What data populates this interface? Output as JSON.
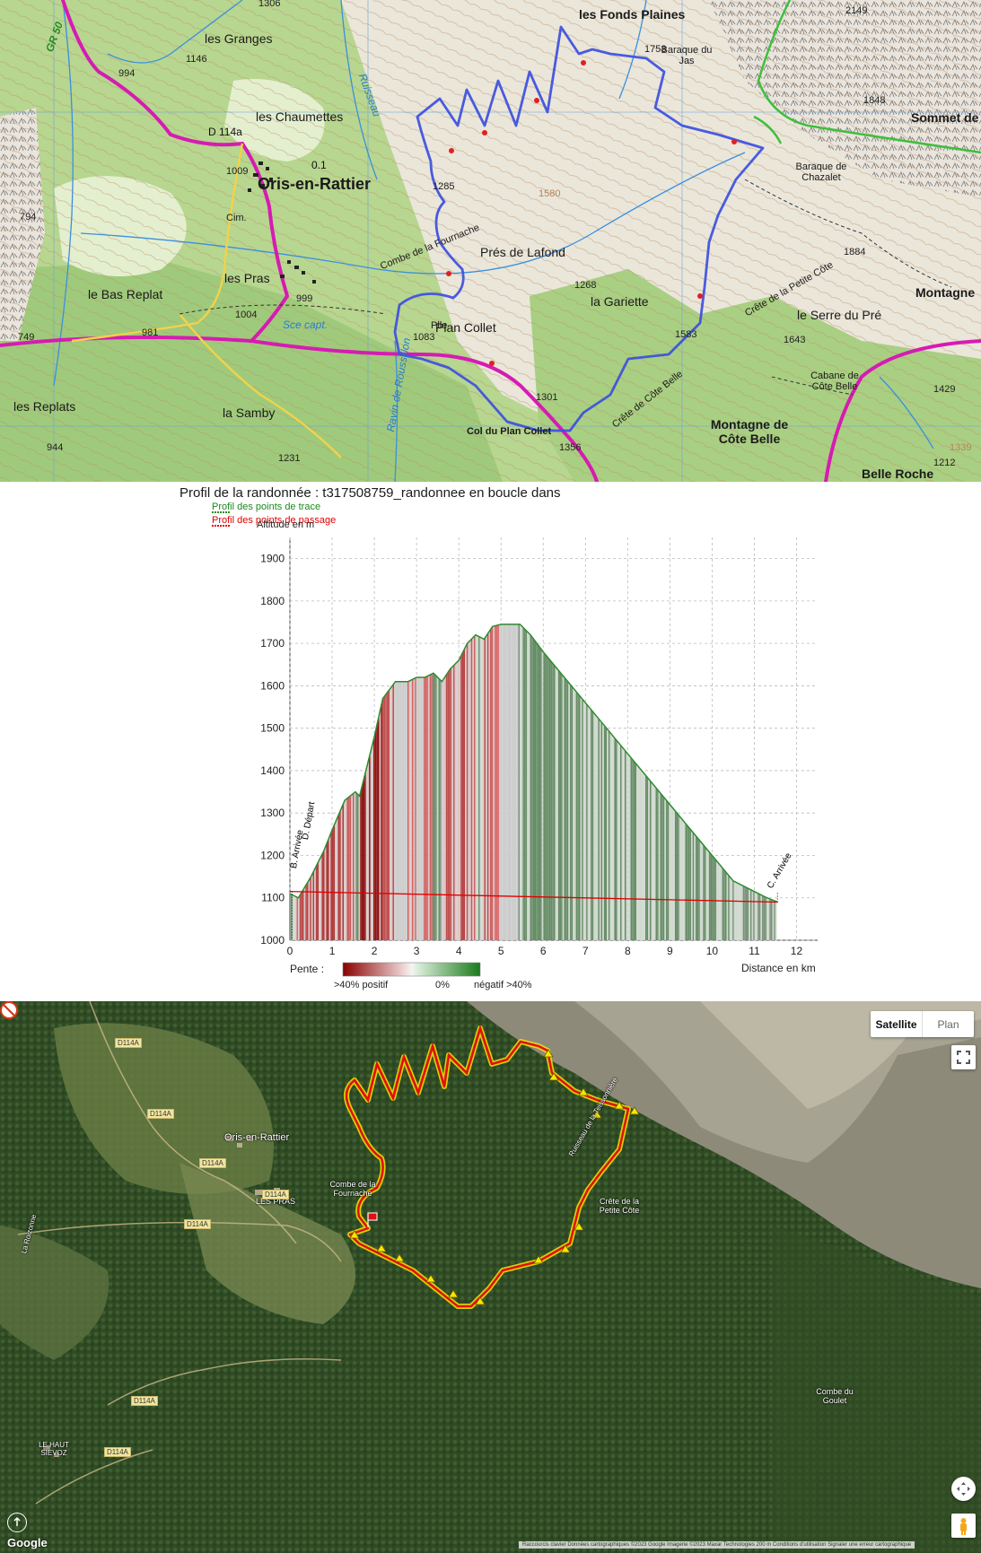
{
  "topo_map": {
    "places": [
      {
        "name": "les Granges"
      },
      {
        "name": "les Chaumettes"
      },
      {
        "name": "Oris-en-Rattier"
      },
      {
        "name": "les Fonds Plaines"
      },
      {
        "name": "Baraque du Jas"
      },
      {
        "name": "Sommet de"
      },
      {
        "name": "Baraque de Chazalet"
      },
      {
        "name": "Combe de la Fournache"
      },
      {
        "name": "Prés de Lafond"
      },
      {
        "name": "la Gariette"
      },
      {
        "name": "Crête de la Petite Côte"
      },
      {
        "name": "Montagne"
      },
      {
        "name": "le Serre du Pré"
      },
      {
        "name": "les Pras"
      },
      {
        "name": "le Bas Replat"
      },
      {
        "name": "Plan Collet"
      },
      {
        "name": "Sce capt."
      },
      {
        "name": "Cabane de Côte Belle"
      },
      {
        "name": "Crête de Côte Belle"
      },
      {
        "name": "Montagne de Côte Belle"
      },
      {
        "name": "Col du Plan Collet"
      },
      {
        "name": "la Samby"
      },
      {
        "name": "les Replats"
      },
      {
        "name": "Belle Roche"
      },
      {
        "name": "Ravin de Roussillon"
      },
      {
        "name": "Ruisseau"
      },
      {
        "name": "Cim."
      },
      {
        "name": "Plle"
      },
      {
        "name": "GR 50"
      }
    ],
    "altitudes": [
      "1306",
      "1146",
      "994",
      "1753",
      "1848",
      "2149",
      "1009",
      "1285",
      "1268",
      "1884",
      "1583",
      "1643",
      "999",
      "1004",
      "981",
      "1083",
      "1301",
      "1356",
      "1231",
      "944",
      "749",
      "794",
      "1429",
      "1212",
      "1339",
      "1580"
    ],
    "roads": [
      "D 114a",
      "0.1"
    ]
  },
  "profile": {
    "title": "Profil de la randonnée : t317508759_randonnee en boucle dans",
    "legend_track": "Profil des points de trace",
    "legend_pass": "Profil des points de passage",
    "ylabel": "Altitude en m",
    "xlabel": "Distance en km",
    "pente_label": "Pente :",
    "pente_pos": ">40%  positif",
    "pente_mid": "0%",
    "pente_neg": "négatif  >40%",
    "markers": [
      "D. Départ",
      "B. Arrivée",
      "C. Arrivée"
    ],
    "colors": {
      "track": "#2e8b2e",
      "pass": "#e00000",
      "ascent": "#a01010",
      "descent": "#2e7a2e"
    }
  },
  "chart_data": {
    "type": "area",
    "title": "Profil de la randonnée : t317508759_randonnee en boucle dans",
    "xlabel": "Distance en km",
    "ylabel": "Altitude en m",
    "xlim": [
      0,
      12.5
    ],
    "ylim": [
      1000,
      1950
    ],
    "xticks": [
      "0",
      "1",
      "2",
      "3",
      "4",
      "5",
      "6",
      "7",
      "8",
      "9",
      "10",
      "11",
      "12"
    ],
    "yticks": [
      "1000",
      "1100",
      "1200",
      "1300",
      "1400",
      "1500",
      "1600",
      "1700",
      "1800",
      "1900"
    ],
    "grid": true,
    "series": [
      {
        "name": "Profil des points de trace",
        "x": [
          0,
          0.2,
          0.5,
          0.8,
          1.0,
          1.3,
          1.55,
          1.65,
          1.8,
          2.0,
          2.2,
          2.5,
          2.8,
          3.0,
          3.2,
          3.4,
          3.6,
          3.8,
          4.0,
          4.2,
          4.4,
          4.6,
          4.8,
          5.0,
          5.2,
          5.45,
          5.7,
          6.0,
          6.5,
          7.0,
          7.5,
          8.0,
          8.5,
          9.0,
          9.5,
          10.0,
          10.5,
          11.0,
          11.3,
          11.55
        ],
        "y": [
          1110,
          1100,
          1150,
          1210,
          1260,
          1330,
          1350,
          1340,
          1400,
          1480,
          1570,
          1610,
          1610,
          1620,
          1620,
          1630,
          1610,
          1640,
          1660,
          1700,
          1720,
          1710,
          1740,
          1745,
          1745,
          1745,
          1720,
          1680,
          1620,
          1560,
          1500,
          1440,
          1380,
          1320,
          1260,
          1200,
          1140,
          1115,
          1100,
          1090
        ]
      },
      {
        "name": "Profil des points de passage",
        "x": [
          0,
          11.55
        ],
        "y": [
          1115,
          1090
        ]
      }
    ]
  },
  "satellite_map": {
    "labels": [
      "Oris-en-Rattier",
      "LES PRAS",
      "Combe de la Fournache",
      "Crête de la Petite Côte",
      "Combe du Goulet",
      "LE HAUT SIEVOZ",
      "La Roizonne",
      "Ruisseau de la Teissonnière"
    ],
    "road_labels": [
      "D114A",
      "D114A",
      "D114A",
      "D114A",
      "D114A",
      "D114A",
      "D114A"
    ],
    "tab_satellite": "Satellite",
    "tab_plan": "Plan",
    "google": "Google",
    "attribution": "Raccourcis clavier   Données cartographiques ©2023 Google Imagerie ©2023 Maxar Technologies   200 m   Conditions d'utilisation   Signaler une erreur cartographique",
    "colors": {
      "route": "#e01010",
      "highlight": "#f5e600"
    }
  }
}
